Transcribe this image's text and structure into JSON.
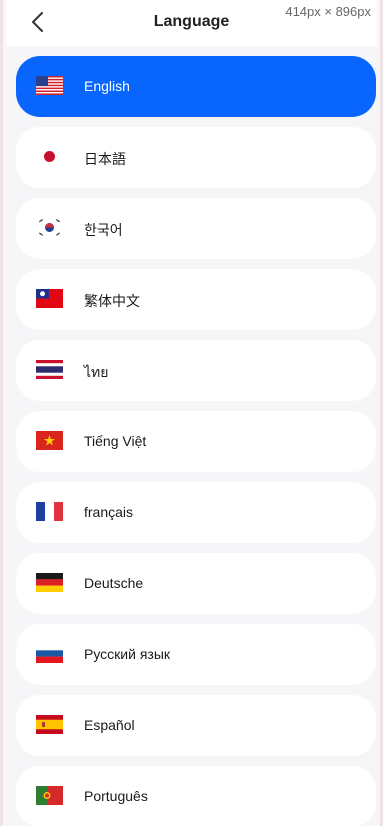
{
  "header": {
    "title": "Language",
    "back_icon": "chevron-left-icon",
    "viewport_label": "414px × 896px"
  },
  "languages": [
    {
      "label": "English",
      "flag": "us-flag-icon",
      "selected": true
    },
    {
      "label": "日本語",
      "flag": "japan-flag-icon",
      "selected": false
    },
    {
      "label": "한국어",
      "flag": "south-korea-flag-icon",
      "selected": false
    },
    {
      "label": "繁体中文",
      "flag": "taiwan-flag-icon",
      "selected": false
    },
    {
      "label": "ไทย",
      "flag": "thailand-flag-icon",
      "selected": false
    },
    {
      "label": "Tiếng Việt",
      "flag": "vietnam-flag-icon",
      "selected": false
    },
    {
      "label": "français",
      "flag": "france-flag-icon",
      "selected": false
    },
    {
      "label": "Deutsche",
      "flag": "germany-flag-icon",
      "selected": false
    },
    {
      "label": "Русский язык",
      "flag": "russia-flag-icon",
      "selected": false
    },
    {
      "label": "Español",
      "flag": "spain-flag-icon",
      "selected": false
    },
    {
      "label": "Português",
      "flag": "portugal-flag-icon",
      "selected": false
    }
  ],
  "colors": {
    "accent": "#0866ff",
    "item_bg": "#ffffff",
    "page_bg": "#f6f6f8"
  }
}
